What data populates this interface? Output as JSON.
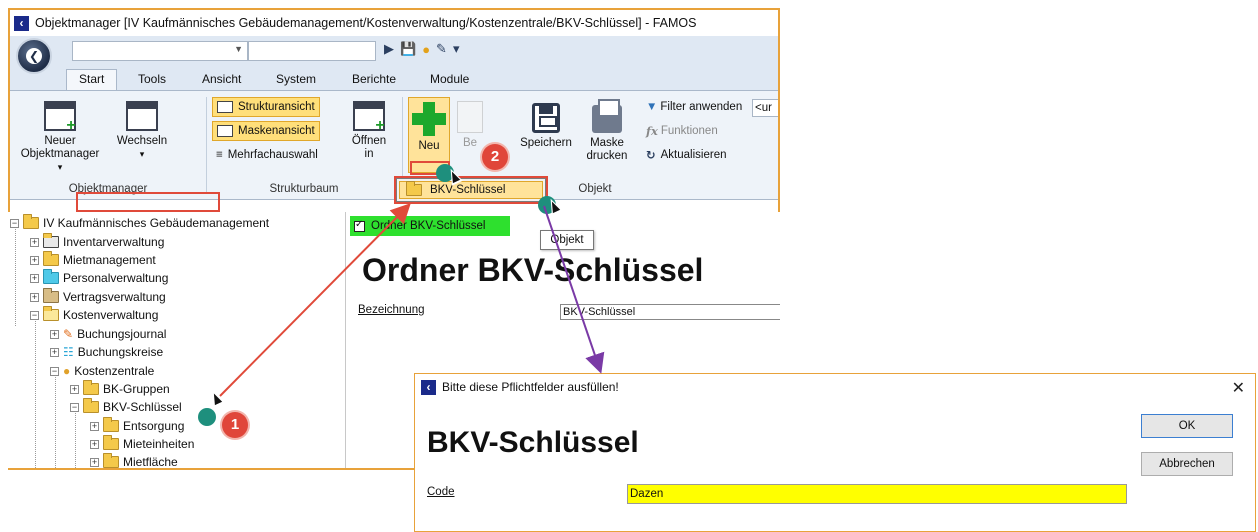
{
  "window": {
    "title": "Objektmanager [IV Kaufmännisches Gebäudemanagement/Kostenverwaltung/Kostenzentrale/BKV-Schlüssel] - FAMOS"
  },
  "tabs": [
    {
      "label": "Start"
    },
    {
      "label": "Tools"
    },
    {
      "label": "Ansicht"
    },
    {
      "label": "System"
    },
    {
      "label": "Berichte"
    },
    {
      "label": "Module"
    }
  ],
  "ribbon": {
    "neuer_objektmanager": "Neuer Objektmanager",
    "wechseln": "Wechseln",
    "group_objektmanager": "Objektmanager",
    "strukturansicht": "Strukturansicht",
    "maskenansicht": "Maskenansicht",
    "mehrfachauswahl": "Mehrfachauswahl",
    "oeffnen_in": "Öffnen in",
    "group_strukturbaum": "Strukturbaum",
    "neu": "Neu",
    "bearbeiten": "Be",
    "speichern": "Speichern",
    "maske_drucken": "Maske drucken",
    "filter_anwenden": "Filter anwenden",
    "filter_value": "<ur",
    "funktionen": "Funktionen",
    "aktualisieren": "Aktualisieren",
    "group_objekt": "Objekt"
  },
  "menu": {
    "item": "BKV-Schlüssel"
  },
  "tooltip": "Objekt",
  "tree": [
    {
      "label": "IV Kaufmännisches Gebäudemanagement",
      "icon": "folder"
    },
    {
      "label": "Inventarverwaltung",
      "icon": "folder-dark"
    },
    {
      "label": "Mietmanagement",
      "icon": "folder"
    },
    {
      "label": "Personalverwaltung",
      "icon": "folder-cyan"
    },
    {
      "label": "Vertragsverwaltung",
      "icon": "folder-brown"
    },
    {
      "label": "Kostenverwaltung",
      "icon": "folder"
    },
    {
      "label": "Buchungsjournal",
      "icon": "book-icon"
    },
    {
      "label": "Buchungskreise",
      "icon": "network-icon"
    },
    {
      "label": "Kostenzentrale",
      "icon": "coins-icon"
    },
    {
      "label": "BK-Gruppen",
      "icon": "folder"
    },
    {
      "label": "BKV-Schlüssel",
      "icon": "folder"
    },
    {
      "label": "Entsorgung",
      "icon": "folder"
    },
    {
      "label": "Mieteinheiten",
      "icon": "folder"
    },
    {
      "label": "Mietfläche",
      "icon": "folder"
    }
  ],
  "detail": {
    "tab_label": "Ordner BKV-Schlüssel",
    "heading": "Ordner BKV-Schlüssel",
    "field_label": "Bezeichnung",
    "field_value": "BKV-Schlüssel"
  },
  "dialog": {
    "title": "Bitte diese Pflichtfelder ausfüllen!",
    "heading": "BKV-Schlüssel",
    "code_label": "Code",
    "code_value": "Dazen",
    "ok": "OK",
    "abbrechen": "Abbrechen"
  },
  "badges": {
    "one": "1",
    "two": "2"
  },
  "colors": {
    "window_border": "#e8a23a",
    "highlight_red": "#e04a3a",
    "badge_red": "#e0463a",
    "teal_dot": "#1e8f7d",
    "green_tab": "#2ee02e",
    "yellow_input": "#ffff00",
    "arrow_purple": "#7a3aa6"
  }
}
